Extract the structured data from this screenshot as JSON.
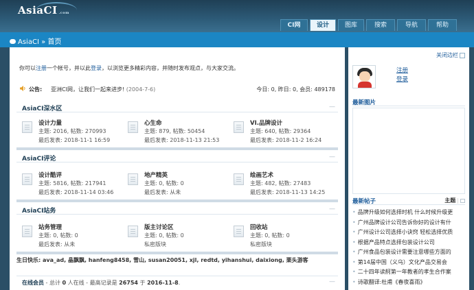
{
  "header": {
    "logo_text": "AsiaCI",
    "logo_suffix": ".com",
    "nav": [
      "CI网",
      "设计",
      "图库",
      "搜索",
      "导航",
      "帮助"
    ]
  },
  "breadcrumb": {
    "text": "AsiaCI » 首页"
  },
  "welcome": {
    "prefix": "你可以",
    "register": "注册",
    "middle": "一个帐号，并以此",
    "login": "登录",
    "suffix": "，以浏览更多精彩内容，并随时发布观点，与大家交流。"
  },
  "notice": {
    "label": "公告:",
    "text": "亚洲CI网，让我们一起来进步!",
    "date": "(2004-7-6)",
    "stats": "今日: 0, 昨日: 0, 会员: 489178"
  },
  "sections": [
    {
      "title": "AsiaCI深水区",
      "forums": [
        {
          "name": "设计力量",
          "counts": "主题: 2016, 帖数: 270993",
          "last": "最后发表: 2018-11-1 16:59"
        },
        {
          "name": "心生命",
          "counts": "主题: 879, 帖数: 50454",
          "last": "最后发表: 2018-11-13 21:53"
        },
        {
          "name": "VI.品牌设计",
          "counts": "主题: 640, 帖数: 29364",
          "last": "最后发表: 2018-11-2 16:24"
        }
      ]
    },
    {
      "title": "AsiaCI评论",
      "forums": [
        {
          "name": "设计酷评",
          "counts": "主题: 5816, 帖数: 217941",
          "last": "最后发表: 2018-11-14 03:46"
        },
        {
          "name": "地产精英",
          "counts": "主题: 0, 帖数: 0",
          "last": "最后发表: 从未"
        },
        {
          "name": "绘画艺术",
          "counts": "主题: 482, 帖数: 27483",
          "last": "最后发表: 2018-11-13 14:25"
        }
      ]
    },
    {
      "title": "AsiaCI站务",
      "forums": [
        {
          "name": "站务管理",
          "counts": "主题: 0, 帖数: 0",
          "last": "最后发表: 从未"
        },
        {
          "name": "版主讨论区",
          "counts": "主题: 0, 帖数: 0",
          "last": "私密版块"
        },
        {
          "name": "回收站",
          "counts": "主题: 0, 帖数: 0",
          "last": "私密版块"
        }
      ]
    }
  ],
  "birthday": "生日快乐: ava_ad, 晶飘飘, hanfeng8458, 雪山, susan20051, xjl, redtd, yihanshui, daixiong, 栗头游客",
  "online": {
    "title": "在线会员",
    "sep": " - 总计 ",
    "total": "0",
    "middle": " 人在线 - 最高记录是 ",
    "record": "26754",
    "at": " 于 ",
    "date": "2016-11-8",
    "end": "."
  },
  "sidebar": {
    "close_label": "关闭边栏",
    "register": "注册",
    "login": "登录",
    "new_images_title": "最新图片",
    "new_posts_title": "最新帖子",
    "tab_topic": "主题",
    "tab_sep": "|",
    "posts": [
      "品牌升级如何选择时机 什么时候升级更",
      "广州品牌设计公司告诉你好的设计有什",
      "广州设计公司选择小诀窍 轻松选择优质",
      "根据产品特点选择包装设计公司",
      "广州食品包装设计需要注意哪些方面的",
      "第14届中国（义乌）文化产品交易会",
      "二十四年读舸第一年教者的孝生合作案",
      "诗歌翻译:杜甫《春夜喜雨》"
    ]
  }
}
